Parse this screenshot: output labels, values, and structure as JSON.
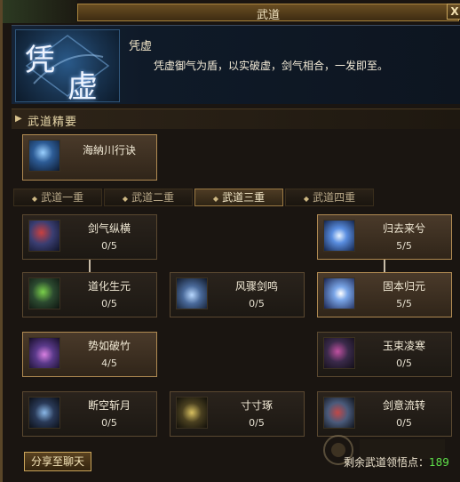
{
  "window": {
    "title": "武道",
    "help_label": "?",
    "close_label": "X"
  },
  "header": {
    "icon_glyph_1": "凭",
    "icon_glyph_2": "虚",
    "title": "凭虚",
    "description": "凭虚御气为盾，以实破虚，剑气相合，一发即至。"
  },
  "section": {
    "label": "武道精要"
  },
  "essence": {
    "name": "海納川行诀"
  },
  "tabs": [
    {
      "label": "武道一重",
      "active": false
    },
    {
      "label": "武道二重",
      "active": false
    },
    {
      "label": "武道三重",
      "active": true
    },
    {
      "label": "武道四重",
      "active": false
    }
  ],
  "skills": [
    {
      "name": "剑气纵横",
      "level": "0/5",
      "active": false,
      "icon": "swirl-blue-icon"
    },
    {
      "name": "归去来兮",
      "level": "5/5",
      "active": true,
      "icon": "moon-slash-icon"
    },
    {
      "name": "道化生元",
      "level": "0/5",
      "active": false,
      "icon": "green-swirl-icon"
    },
    {
      "name": "风骤剑鸣",
      "level": "0/5",
      "active": false,
      "icon": "wind-blade-icon"
    },
    {
      "name": "固本归元",
      "level": "5/5",
      "active": true,
      "icon": "crescent-moon-icon"
    },
    {
      "name": "势如破竹",
      "level": "4/5",
      "active": true,
      "icon": "fist-strike-icon"
    },
    {
      "name": "玉束凌寒",
      "level": "0/5",
      "active": false,
      "icon": "ice-swirl-icon"
    },
    {
      "name": "断空斩月",
      "level": "0/5",
      "active": false,
      "icon": "trident-moon-icon"
    },
    {
      "name": "寸寸琢",
      "level": "0/5",
      "active": false,
      "icon": "trident-gold-icon"
    },
    {
      "name": "剑意流转",
      "level": "0/5",
      "active": false,
      "icon": "sword-flow-icon"
    }
  ],
  "footer": {
    "share_label": "分享至聊天",
    "points_label": "剩余武道领悟点：",
    "points_value": "189"
  },
  "colors": {
    "accent_gold": "#b08a52",
    "points_green": "#5fe04a"
  }
}
